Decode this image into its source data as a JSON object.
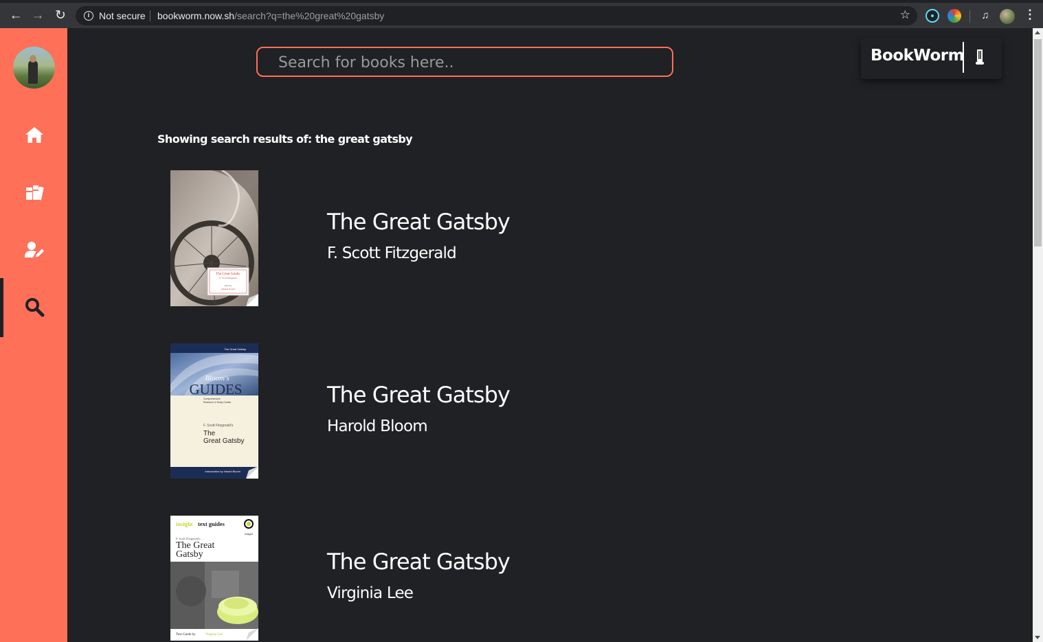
{
  "browser": {
    "security_label": "Not secure",
    "url_host": "bookworm.now.sh",
    "url_path": "/search?q=the%20great%20gatsby"
  },
  "app": {
    "brand": "BookWorm",
    "accent_color": "#ff7058",
    "background_color": "#202124"
  },
  "sidebar": {
    "items": [
      {
        "name": "home",
        "icon": "home-icon"
      },
      {
        "name": "library",
        "icon": "books-icon"
      },
      {
        "name": "profile",
        "icon": "user-edit-icon"
      },
      {
        "name": "search",
        "icon": "search-icon",
        "active": true
      }
    ]
  },
  "search": {
    "placeholder": "Search for books here..",
    "value": ""
  },
  "results": {
    "heading": "Showing search results of: the great gatsby",
    "books": [
      {
        "title": "The Great Gatsby",
        "author": "F. Scott Fitzgerald",
        "cover_text": [
          "The Great Gatsby",
          "F. Scott Fitzgerald",
          "edited by",
          "Michael Nowlin"
        ]
      },
      {
        "title": "The Great Gatsby",
        "author": "Harold Bloom",
        "cover_text": [
          "The Great Gatsby",
          "Bloom's",
          "GUIDES",
          "Comprehensive",
          "Research & Study Guides",
          "F. Scott Fitzgerald's",
          "The",
          "Great Gatsby",
          "Introduction by Harold Bloom"
        ]
      },
      {
        "title": "The Great Gatsby",
        "author": "Virginia Lee",
        "cover_text": [
          "insight",
          "text guides",
          "insight",
          "F. Scott Fitzgerald's",
          "The Great",
          "Gatsby",
          "Text Guide by",
          "Virginia Lee"
        ]
      }
    ]
  }
}
